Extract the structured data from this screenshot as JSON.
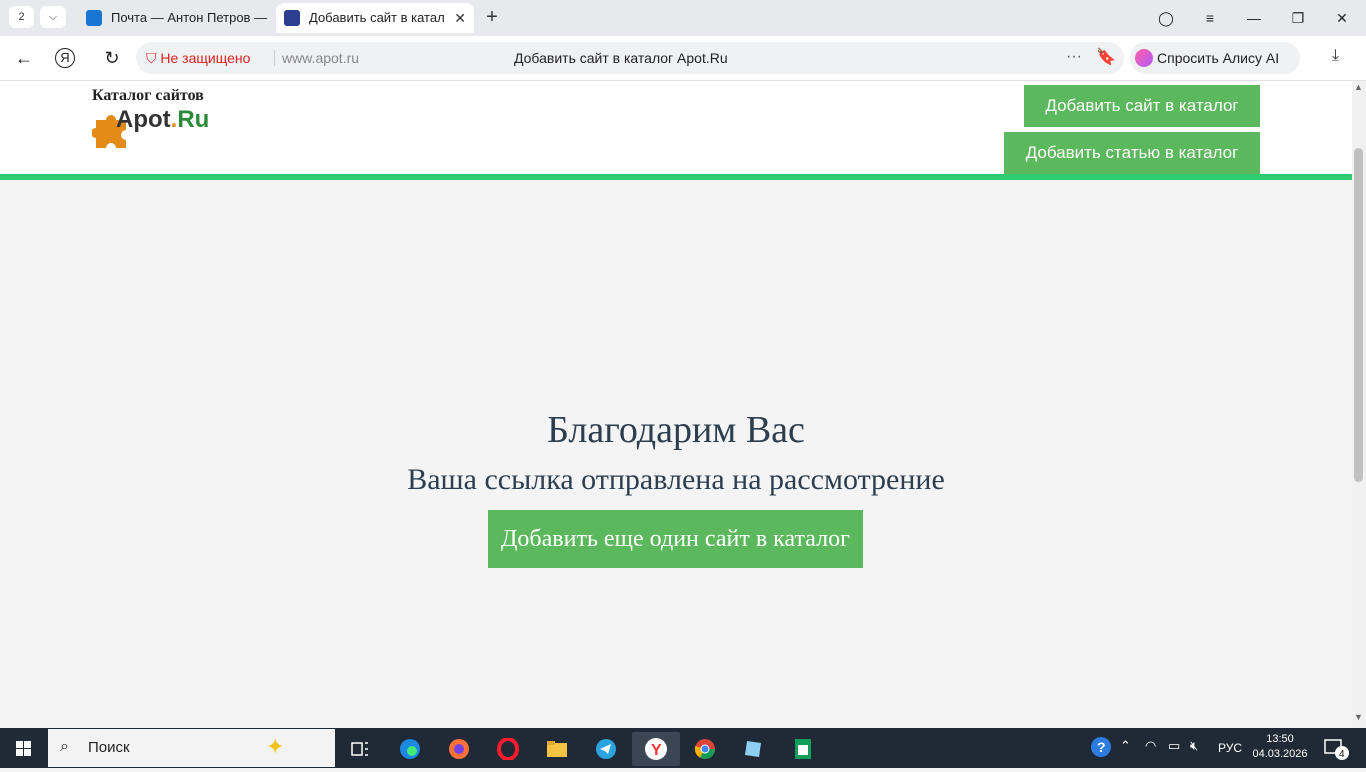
{
  "tabs": {
    "counter": "2",
    "chevron": "⌵",
    "items": [
      {
        "title": "Почта — Антон Петров —",
        "favicon_color": "#1976d2"
      },
      {
        "title": "Добавить сайт в катал",
        "favicon_color": "#2c3e8f"
      }
    ],
    "close": "✕",
    "new_tab": "+"
  },
  "window": {
    "account": "◯",
    "menu": "≡",
    "minimize": "—",
    "restore": "❐",
    "close": "✕"
  },
  "address": {
    "back": "←",
    "yandex": "Я",
    "reload": "↻",
    "security_icon": "⛉",
    "security_text": "Не защищено",
    "url": "www.apot.ru",
    "title": "Добавить сайт в каталог Apot.Ru",
    "more": "···",
    "bookmark": "🔖",
    "alice": "Спросить Алису AI",
    "download": "⤓"
  },
  "site": {
    "logo_caption": "Каталог сайтов",
    "logo_a": "Apot",
    "logo_dot": ".",
    "logo_ru": "Ru",
    "buttons": {
      "add_site": "Добавить сайт в каталог",
      "add_article": "Добавить статью в каталог"
    },
    "accent": "#2ecc71",
    "button_color": "#5cb85c"
  },
  "content": {
    "thanks": "Благодарим Вас",
    "sent": "Ваша ссылка отправлена на рассмотрение",
    "add_another": "Добавить еще один сайт в каталог"
  },
  "taskbar": {
    "search": "Поиск",
    "search_icon": "⌕",
    "sparkle": "✦",
    "apps": [
      "task-view",
      "edge",
      "firefox",
      "opera",
      "explorer",
      "telegram",
      "yandex-browser",
      "chrome",
      "notes",
      "sheets"
    ],
    "lang": "РУС",
    "time": "13:50",
    "date": "04.03.2026",
    "notifications": "4",
    "help": "?",
    "chevron": "⌃",
    "wifi": "◠",
    "battery": "▭",
    "volume": "🔇︎"
  }
}
